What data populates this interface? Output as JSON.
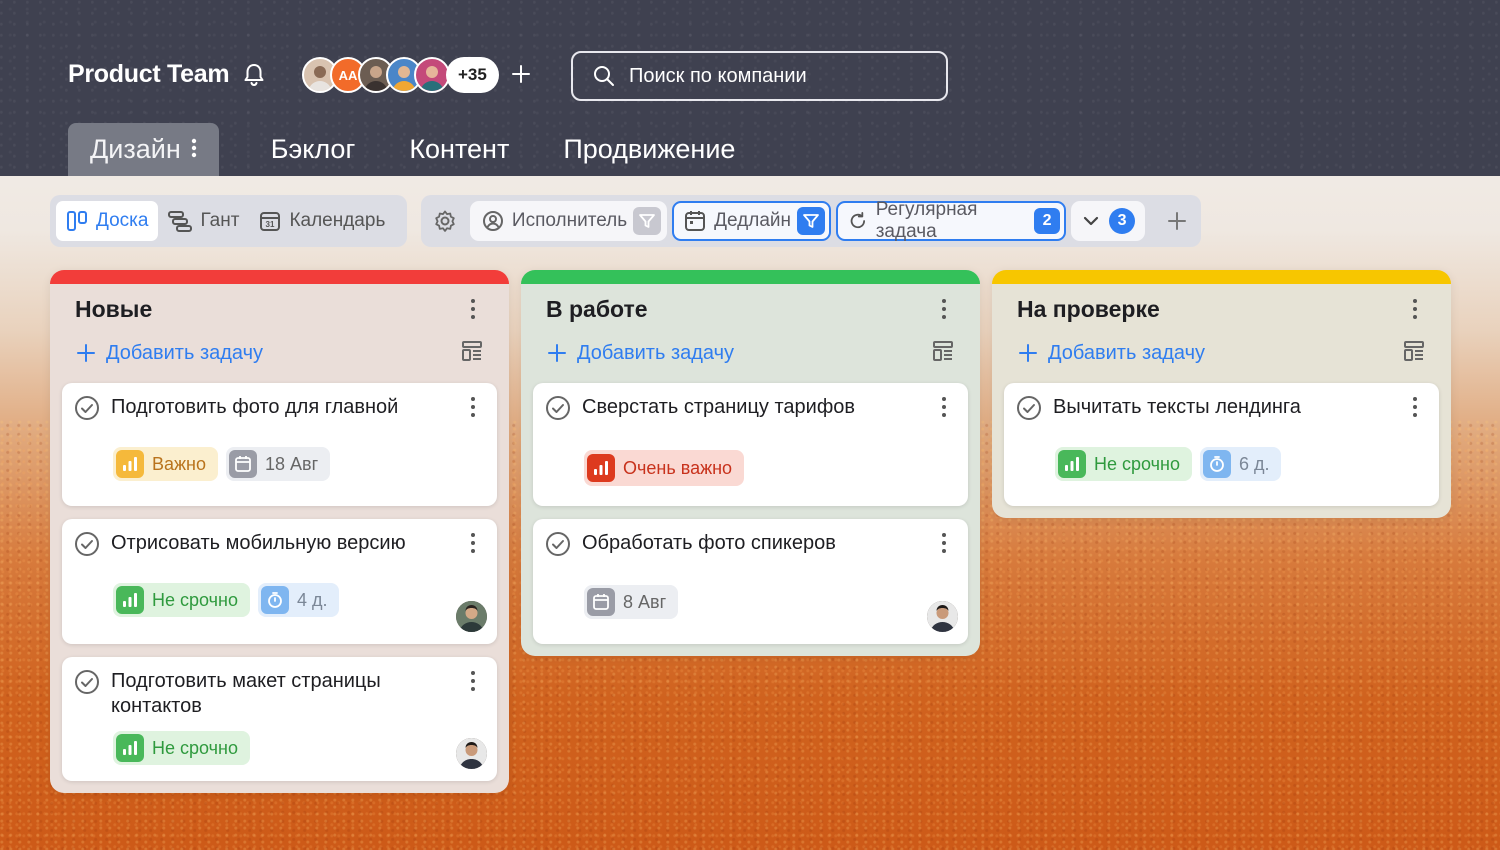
{
  "header": {
    "team_name": "Product Team",
    "members": [
      {
        "initials": "",
        "color": "#d9c3b0"
      },
      {
        "initials": "AA",
        "color": "#f26b2a"
      },
      {
        "initials": "",
        "color": "#6c5d52"
      },
      {
        "initials": "",
        "color": "#4a86c8"
      },
      {
        "initials": "",
        "color": "#c44a7a"
      }
    ],
    "members_more": "+35",
    "search_placeholder": "Поиск по компании"
  },
  "tabs": [
    {
      "label": "Дизайн",
      "active": true
    },
    {
      "label": "Бэклог"
    },
    {
      "label": "Контент"
    },
    {
      "label": "Продвижение"
    }
  ],
  "views": {
    "board": "Доска",
    "gantt": "Гант",
    "calendar": "Календарь"
  },
  "filters": {
    "assignee": "Исполнитель",
    "deadline": "Дедлайн",
    "recurring": "Регулярная задача",
    "recurring_count": "2",
    "more_count": "3"
  },
  "columns": [
    {
      "title": "Новые",
      "color": "#f23d3a",
      "bg": "#eaded9",
      "add_label": "Добавить задачу",
      "cards": [
        {
          "title": "Подготовить фото для главной",
          "priority": "Важно",
          "date": "18 Авг"
        },
        {
          "title": "Отрисовать мобильную версию",
          "priority": "Не срочно",
          "estimate": "4 д."
        },
        {
          "title": "Подготовить макет страницы контактов",
          "priority": "Не срочно"
        }
      ]
    },
    {
      "title": "В работе",
      "color": "#34c15a",
      "bg": "#dde4db",
      "add_label": "Добавить задачу",
      "cards": [
        {
          "title": "Сверстать страницу тарифов",
          "priority": "Очень важно"
        },
        {
          "title": "Обработать фото спикеров",
          "date": "8 Авг"
        }
      ]
    },
    {
      "title": "На проверке",
      "color": "#f7c600",
      "bg": "#e6e3d6",
      "add_label": "Добавить задачу",
      "cards": [
        {
          "title": "Вычитать тексты лендинга",
          "priority": "Не срочно",
          "estimate": "6 д."
        }
      ]
    }
  ]
}
